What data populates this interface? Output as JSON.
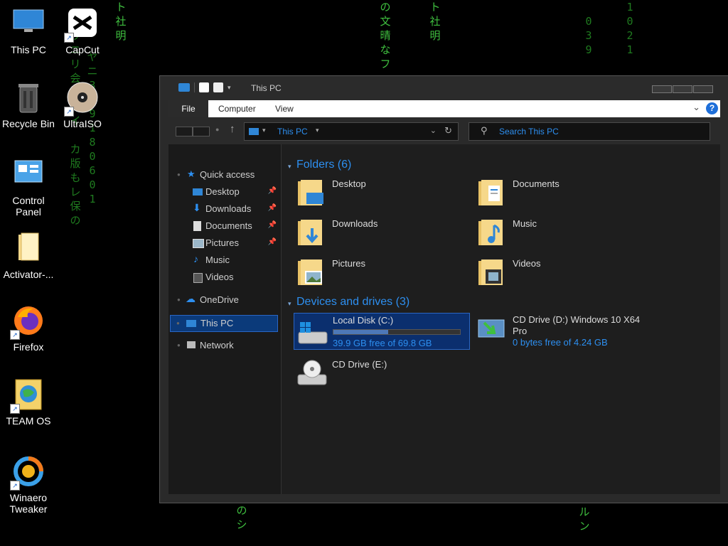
{
  "desktop": {
    "icons": [
      {
        "label": "This PC"
      },
      {
        "label": "CapCut"
      },
      {
        "label": "Recycle Bin"
      },
      {
        "label": "UltraISO"
      },
      {
        "label": "Control Panel"
      },
      {
        "label": "Activator-..."
      },
      {
        "label": "Firefox"
      },
      {
        "label": "TEAM OS"
      },
      {
        "label": "Winaero Tweaker"
      }
    ]
  },
  "window": {
    "title": "This PC",
    "ribbon": {
      "file": "File",
      "computer": "Computer",
      "view": "View",
      "help": "?"
    },
    "address": "This PC",
    "search_placeholder": "Search This PC",
    "nav": {
      "quick_access": "Quick access",
      "items": [
        "Desktop",
        "Downloads",
        "Documents",
        "Pictures",
        "Music",
        "Videos"
      ],
      "onedrive": "OneDrive",
      "this_pc": "This PC",
      "network": "Network"
    },
    "folders_header": "Folders (6)",
    "folders": [
      "Desktop",
      "Documents",
      "Downloads",
      "Music",
      "Pictures",
      "Videos"
    ],
    "devices_header": "Devices and drives (3)",
    "drives": {
      "c": {
        "name": "Local Disk (C:)",
        "free": "39.9 GB free of 69.8 GB",
        "used_fraction": 0.43
      },
      "d": {
        "name": "CD Drive (D:) Windows 10 X64 Pro",
        "free": "0 bytes free of 4.24 GB"
      },
      "e": {
        "name": "CD Drive (E:)"
      }
    }
  },
  "colors": {
    "accent": "#2d8ff0",
    "selection": "#0b3a7a"
  }
}
